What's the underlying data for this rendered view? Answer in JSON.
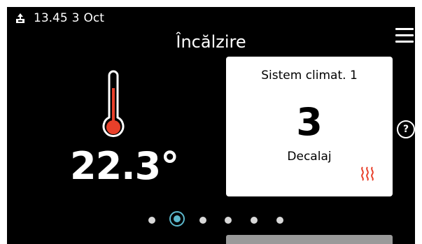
{
  "status": {
    "usb_icon": "usb-upload-icon",
    "time": "13.45",
    "day": "3",
    "month": "Oct"
  },
  "header": {
    "title": "Încălzire",
    "menu_icon": "hamburger-menu-icon"
  },
  "indoor": {
    "thermometer_icon": "thermometer-icon",
    "temperature": "22.3°"
  },
  "card": {
    "title": "Sistem climat. 1",
    "value": "3",
    "label": "Decalaj",
    "heat_icon": "heat-waves-icon"
  },
  "help": {
    "icon": "help-icon",
    "text": "?"
  },
  "pagination": {
    "pages": 6,
    "active_index": 1,
    "active_color": "#5cb8cc"
  },
  "colors": {
    "background": "#000000",
    "thermometer_red": "#e8402a",
    "heat_icon_red": "#e8402a"
  }
}
